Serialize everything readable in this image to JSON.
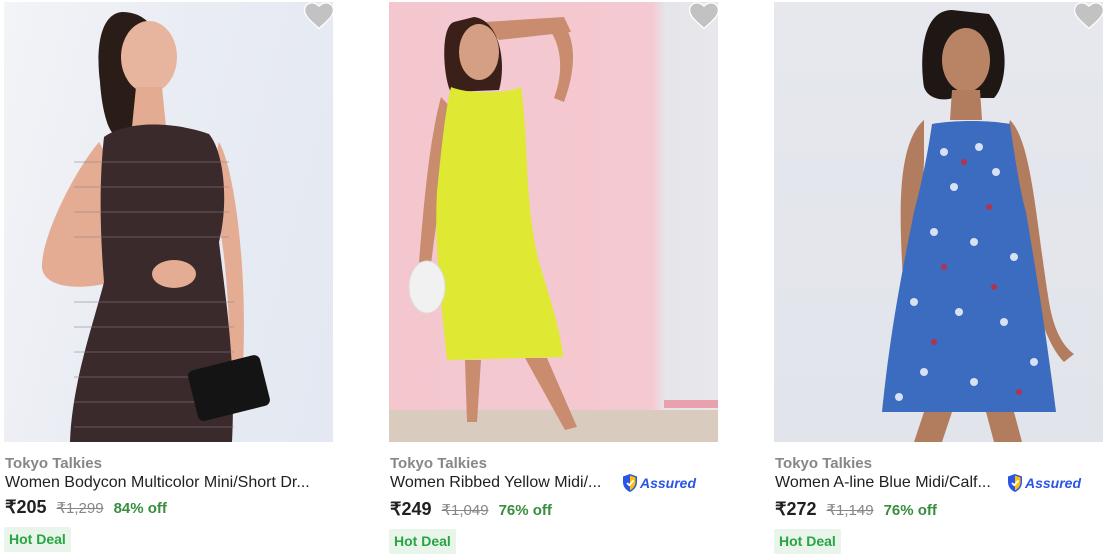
{
  "products": [
    {
      "brand": "Tokyo Talkies",
      "title": "Women Bodycon Multicolor Mini/Short Dr...",
      "assured": false,
      "price": "₹205",
      "mrp": "₹1,299",
      "discount": "84% off",
      "deal": "Hot Deal",
      "wishlist_icon": "heart-icon"
    },
    {
      "brand": "Tokyo Talkies",
      "title": "Women Ribbed Yellow Midi/...",
      "assured": true,
      "assured_label": "Assured",
      "price": "₹249",
      "mrp": "₹1,049",
      "discount": "76% off",
      "deal": "Hot Deal",
      "wishlist_icon": "heart-icon"
    },
    {
      "brand": "Tokyo Talkies",
      "title": "Women A-line Blue Midi/Calf...",
      "assured": true,
      "assured_label": "Assured",
      "price": "₹272",
      "mrp": "₹1,149",
      "discount": "76% off",
      "deal": "Hot Deal",
      "wishlist_icon": "heart-icon"
    }
  ],
  "colors": {
    "brand_text": "#878787",
    "discount_green": "#388e3c",
    "deal_bg": "#e9f5ea",
    "deal_text": "#26a541",
    "assured_blue": "#2a55e5",
    "wishlist_grey": "#c2c2c2"
  }
}
